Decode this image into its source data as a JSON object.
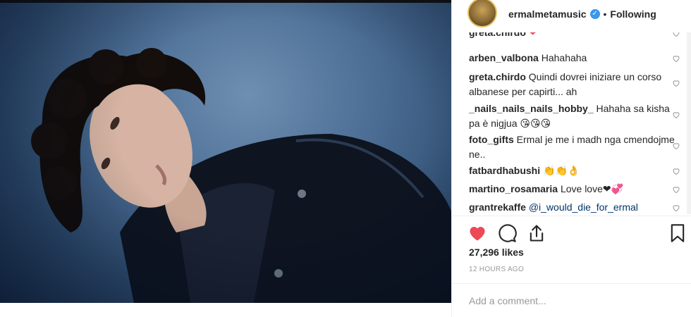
{
  "header": {
    "username": "ermalmetamusic",
    "separator": "•",
    "follow_status": "Following"
  },
  "comments": [
    {
      "user": "greta.chirdo",
      "text": "❤"
    },
    {
      "user": "arben_valbona",
      "text": "Hahahaha"
    },
    {
      "user": "greta.chirdo",
      "text": "Quindi dovrei iniziare un corso albanese per capirti... ah"
    },
    {
      "user": "_nails_nails_nails_hobby_",
      "text": "Hahaha sa kisha pa è nigjua 😘😘😘"
    },
    {
      "user": "foto_gifts",
      "text": "Ermal je me i madh nga cmendojme ne.."
    },
    {
      "user": "fatbardhabushi",
      "text": "👏👏👌"
    },
    {
      "user": "martino_rosamaria",
      "text": "Love love❤💞"
    },
    {
      "user": "grantrekaffe",
      "text": "@i_would_die_for_ermal"
    }
  ],
  "likes": "27,296 likes",
  "time": "12 HOURS AGO",
  "comment_input": {
    "placeholder": "Add a comment..."
  },
  "colors": {
    "like_red": "#ed4956",
    "link_blue": "#003569",
    "verified_blue": "#3897f0"
  }
}
